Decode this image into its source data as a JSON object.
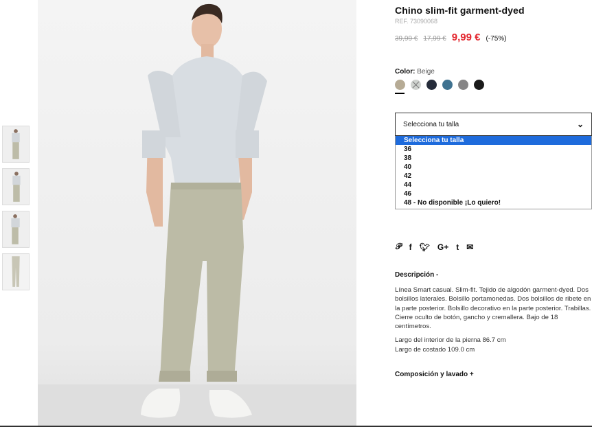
{
  "product": {
    "title": "Chino slim-fit garment-dyed",
    "ref": "REF. 73090068",
    "price_original": "39,99 €",
    "price_previous": "17,99 €",
    "price_current": "9,99 €",
    "discount": "(-75%)"
  },
  "color": {
    "label": "Color:",
    "value": "Beige",
    "swatches": [
      {
        "name": "beige",
        "hex": "#b6ab95"
      },
      {
        "name": "light-grey-unavailable",
        "hex": "#cfd3cf"
      },
      {
        "name": "navy",
        "hex": "#252c3a"
      },
      {
        "name": "teal-blue",
        "hex": "#3f7290"
      },
      {
        "name": "grey",
        "hex": "#868586"
      },
      {
        "name": "black",
        "hex": "#1a1a1a"
      }
    ]
  },
  "size": {
    "selected_label": "Selecciona tu talla",
    "options": [
      "Selecciona tu talla",
      "36",
      "38",
      "40",
      "42",
      "44",
      "46",
      "48 - No disponible ¡Lo quiero!"
    ]
  },
  "social_icons": [
    "pinterest-icon",
    "facebook-icon",
    "twitter-icon",
    "google-plus-icon",
    "tumblr-icon",
    "email-icon"
  ],
  "description": {
    "heading": "Descripción -",
    "text": "Línea Smart casual. Slim-fit. Tejido de algodón garment-dyed. Dos bolsillos laterales. Bolsillo portamonedas. Dos bolsillos de ribete en la parte posterior. Bolsillo decorativo en la parte posterior. Trabillas. Cierre oculto de botón, gancho y cremallera. Bajo de 18 centímetros.",
    "measure_1": "Largo del interior de la pierna 86.7 cm",
    "measure_2": "Largo de costado 109.0 cm"
  },
  "composition": {
    "heading": "Composición y lavado +"
  },
  "colors": {
    "sale_red": "#e3262e",
    "select_blue": "#1e6bdc"
  }
}
